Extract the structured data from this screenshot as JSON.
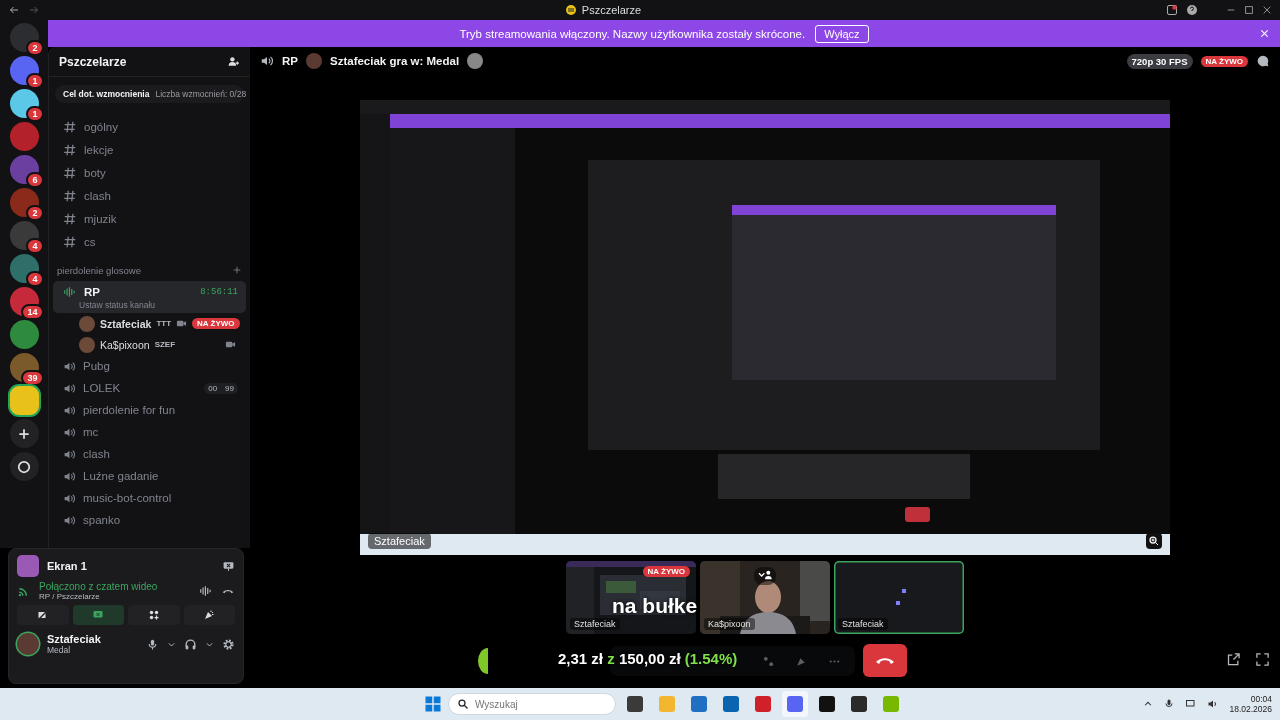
{
  "titlebar": {
    "title": "Pszczelarze"
  },
  "servers": [
    {
      "badge": "2",
      "color": "#2b2d31",
      "selected": false
    },
    {
      "badge": "1",
      "color": "#5865f2",
      "selected": false
    },
    {
      "badge": "1",
      "color": "#5bc8e8",
      "selected": false
    },
    {
      "color": "#b3212b",
      "selected": false
    },
    {
      "badge": "6",
      "color": "#6b3fa0",
      "selected": false
    },
    {
      "badge": "2",
      "color": "#8a2a1a",
      "selected": false
    },
    {
      "badge": "4",
      "color": "#3a3a3a",
      "selected": false
    },
    {
      "badge": "4",
      "color": "#2f6f6a",
      "selected": false
    },
    {
      "badge": "14",
      "color": "#c62a3a",
      "selected": false
    },
    {
      "color": "#2e8b3e",
      "selected": false
    },
    {
      "badge": "39",
      "color": "#7a5a2a",
      "selected": false
    },
    {
      "color": "#e8c21a",
      "selected": true
    }
  ],
  "banner": {
    "text": "Tryb streamowania włączony. Nazwy użytkownika zostały skrócone.",
    "button": "Wyłącz"
  },
  "sidebar": {
    "server_name": "Pszczelarze",
    "boost": {
      "label": "Cel dot. wzmocnienia",
      "count": "Liczba wzmocnień: 0/28"
    },
    "text_channels": [
      {
        "name": "ogólny"
      },
      {
        "name": "lekcje"
      },
      {
        "name": "boty"
      },
      {
        "name": "clash"
      },
      {
        "name": "mjuzik"
      },
      {
        "name": "cs"
      }
    ],
    "category": "pierdolenie glosowe",
    "voice_channels": [
      {
        "name": "RP",
        "selected": true,
        "timer": "8:56:11",
        "status": "Ustaw status kanału",
        "members": [
          {
            "name": "Sztafeciak",
            "tag": "TTT",
            "live": true,
            "label": "NA ŻYWO"
          },
          {
            "name": "Ka$pixoon",
            "tag": "SZEF",
            "live": false
          }
        ]
      },
      {
        "name": "Pubg",
        "selected": false
      },
      {
        "name": "LOLEK",
        "selected": false,
        "counts": [
          "00",
          "99"
        ]
      },
      {
        "name": "pierdolenie for fun",
        "selected": false
      },
      {
        "name": "mc",
        "selected": false
      },
      {
        "name": "clash",
        "selected": false
      },
      {
        "name": "Luźne gadanie",
        "selected": false
      },
      {
        "name": "music-bot-control",
        "selected": false
      },
      {
        "name": "spanko",
        "selected": false
      }
    ]
  },
  "voice_panel": {
    "stream": "Ekran 1",
    "status": "Połączono z czatem wideo",
    "location": "RP / Pszczelarze",
    "user": "Sztafeciak",
    "activity": "Medal"
  },
  "header": {
    "channel": "RP",
    "activity": "Sztafeciak gra w: Medal",
    "quality": "720p 30 FPS",
    "live": "NA ŻYWO"
  },
  "stage": {
    "stream_label": "Sztafeciak"
  },
  "tiles": [
    {
      "kind": "screen",
      "name": "Sztafeciak",
      "live": true,
      "live_label": "NA ŻYWO",
      "speaking": false
    },
    {
      "kind": "camera",
      "name": "Ka$pixoon",
      "live": false,
      "speaking": false
    },
    {
      "kind": "empty",
      "name": "Sztafeciak",
      "live": false,
      "speaking": true
    }
  ],
  "overlay": {
    "caption": "na bułke",
    "goal": [
      {
        "text": "2,31 zł",
        "accent": false
      },
      {
        "text": "z",
        "accent": true
      },
      {
        "text": "150,00 zł",
        "accent": false
      },
      {
        "text": "(1.54%)",
        "accent": true
      }
    ]
  },
  "taskbar": {
    "search_placeholder": "Wyszukaj",
    "apps": [
      {
        "color": "#3a3a3a",
        "selected": false
      },
      {
        "color": "#f2b630",
        "selected": false
      },
      {
        "color": "#1f6fc2",
        "selected": false
      },
      {
        "color": "#0a64b0",
        "selected": false
      },
      {
        "color": "#d0202a",
        "selected": false
      },
      {
        "color": "#5865f2",
        "selected": true
      },
      {
        "color": "#111111",
        "selected": false
      },
      {
        "color": "#2a2a2a",
        "selected": false
      },
      {
        "color": "#76b900",
        "selected": false
      }
    ],
    "time": "00:04",
    "date": "18.02.2026"
  }
}
